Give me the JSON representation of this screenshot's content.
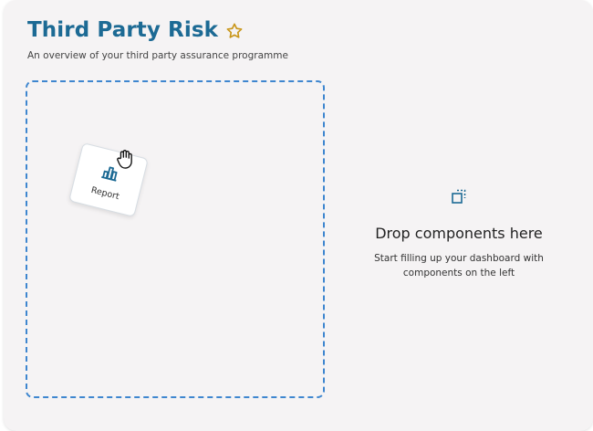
{
  "header": {
    "title": "Third Party Risk",
    "subtitle": "An overview of your third party assurance programme",
    "favorite_icon": "star-outline-icon"
  },
  "drag_card": {
    "label": "Report",
    "icon": "bar-chart-icon"
  },
  "cursor": {
    "icon": "grab-hand-icon"
  },
  "empty_state": {
    "icon": "drop-target-icon",
    "title": "Drop components here",
    "description": "Start filling up your dashboard with components on the left"
  },
  "colors": {
    "accent": "#1c6a94",
    "dashed_border": "#3e86cf",
    "star": "#c9961a",
    "panel_bg": "#f5f3f4"
  }
}
